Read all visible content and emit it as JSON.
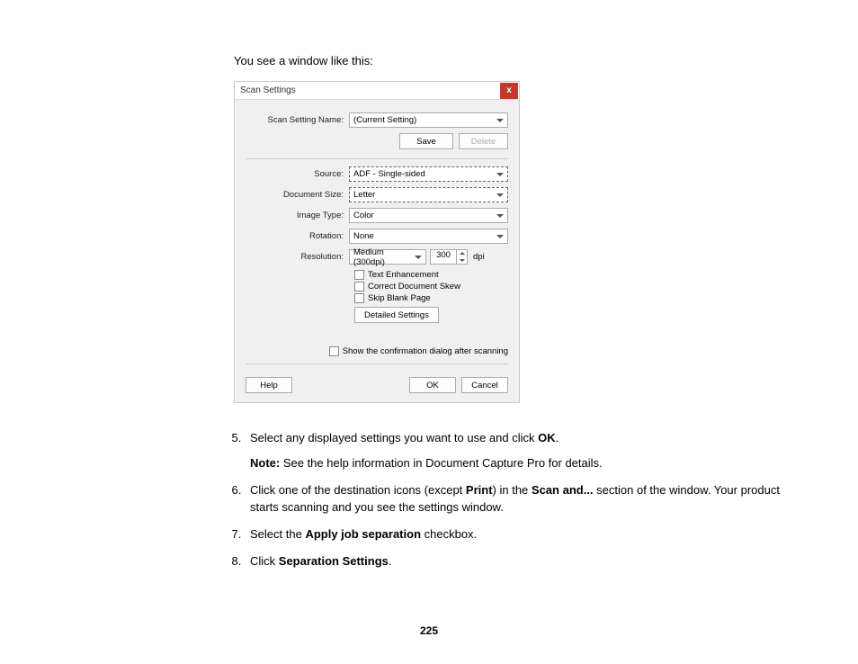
{
  "intro": "You see a window like this:",
  "dialog": {
    "title": "Scan Settings",
    "close_icon": "x",
    "name_row": {
      "label": "Scan Setting Name:",
      "value": "(Current Setting)"
    },
    "save_btn": "Save",
    "delete_btn": "Delete",
    "source_row": {
      "label": "Source:",
      "value": "ADF - Single-sided"
    },
    "docsize_row": {
      "label": "Document Size:",
      "value": "Letter"
    },
    "imagetype_row": {
      "label": "Image Type:",
      "value": "Color"
    },
    "rotation_row": {
      "label": "Rotation:",
      "value": "None"
    },
    "resolution_row": {
      "label": "Resolution:",
      "value": "Medium (300dpi)",
      "num": "300",
      "unit": "dpi"
    },
    "cb_text_enh": "Text Enhancement",
    "cb_skew": "Correct Document Skew",
    "cb_skip": "Skip Blank Page",
    "detailed_btn": "Detailed Settings",
    "confirm_cb": "Show the confirmation dialog after scanning",
    "help_btn": "Help",
    "ok_btn": "OK",
    "cancel_btn": "Cancel"
  },
  "steps": {
    "s5_a": "Select any displayed settings you want to use and click ",
    "s5_b": "OK",
    "s5_c": ".",
    "note_label": "Note:",
    "note_text": " See the help information in Document Capture Pro for details.",
    "s6_a": "Click one of the destination icons (except ",
    "s6_b": "Print",
    "s6_c": ") in the ",
    "s6_d": "Scan and...",
    "s6_e": " section of the window. Your product starts scanning and you see the settings window.",
    "s7_a": "Select the ",
    "s7_b": "Apply job separation",
    "s7_c": " checkbox.",
    "s8_a": "Click ",
    "s8_b": "Separation Settings",
    "s8_c": "."
  },
  "page_number": "225"
}
